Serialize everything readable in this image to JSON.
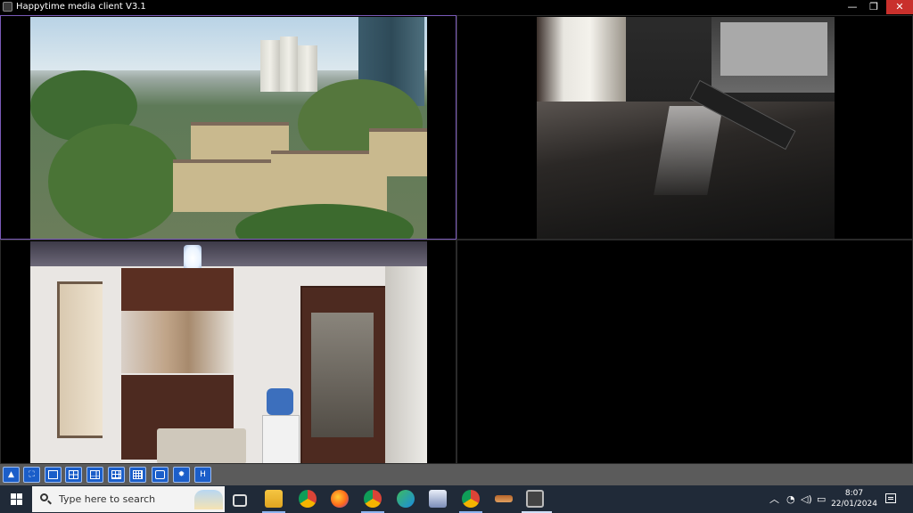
{
  "window": {
    "title": "Happytime media client V3.1",
    "controls": {
      "minimize": "—",
      "restore": "❐",
      "close": "✕"
    }
  },
  "video_grid": {
    "layout": "2x2",
    "active_cell": 1,
    "cells": [
      {
        "id": 1,
        "scene": "city-view-feed"
      },
      {
        "id": 2,
        "scene": "desk-feed"
      },
      {
        "id": 3,
        "scene": "room-feed"
      },
      {
        "id": 4,
        "scene": "empty"
      }
    ]
  },
  "toolbar": {
    "buttons": [
      {
        "name": "snapshot-button",
        "icon": "camera-icon",
        "glyph": "▲"
      },
      {
        "name": "fullscreen-button",
        "icon": "fullscreen-icon",
        "glyph": "⛶"
      },
      {
        "name": "layout-1-button",
        "icon": "layout-1-icon",
        "glyph": ""
      },
      {
        "name": "layout-4-button",
        "icon": "layout-4-icon",
        "glyph": ""
      },
      {
        "name": "layout-6-button",
        "icon": "layout-6-icon",
        "glyph": ""
      },
      {
        "name": "layout-9-button",
        "icon": "layout-9-icon",
        "glyph": ""
      },
      {
        "name": "layout-16-button",
        "icon": "layout-16-icon",
        "glyph": ""
      },
      {
        "name": "record-button",
        "icon": "record-icon",
        "glyph": ""
      },
      {
        "name": "settings-button",
        "icon": "gear-icon",
        "glyph": "✹"
      },
      {
        "name": "help-button",
        "icon": "help-icon",
        "glyph": "H"
      }
    ]
  },
  "taskbar": {
    "search_placeholder": "Type here to search",
    "time": "8:07",
    "date": "22/01/2024",
    "apps": [
      "task-view-icon",
      "file-explorer-icon",
      "chrome-icon",
      "firefox-icon",
      "chrome-profile-icon",
      "edge-icon",
      "app-icon",
      "chrome-alt-icon",
      "game-icon",
      "media-client-icon"
    ]
  },
  "colors": {
    "accent": "#1b5ec9",
    "active_border": "#7a5ab8",
    "close": "#c9302c",
    "taskbar": "#202a38"
  }
}
